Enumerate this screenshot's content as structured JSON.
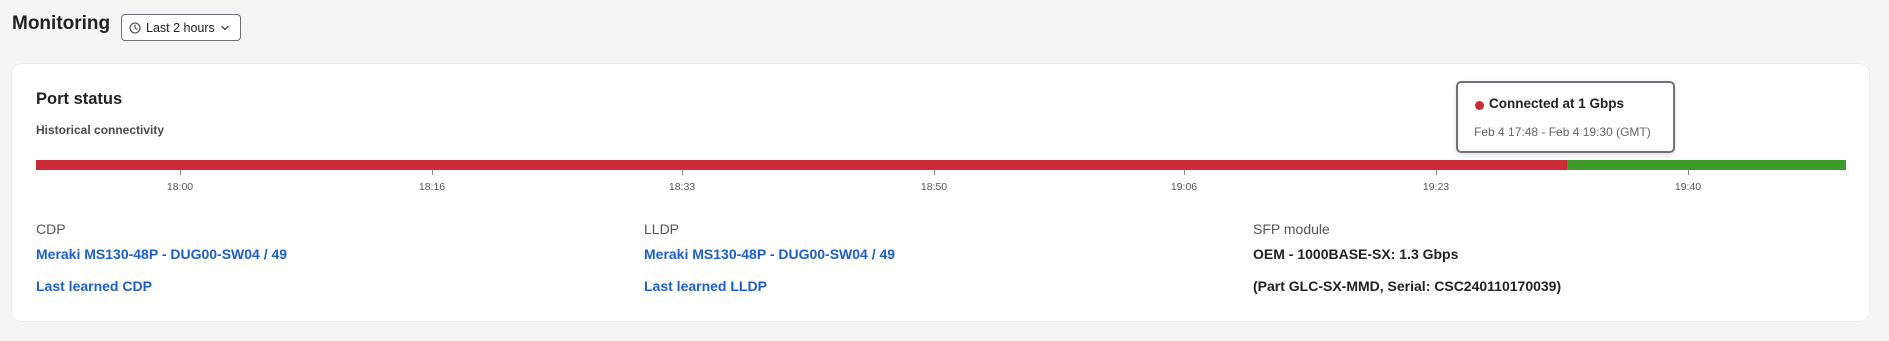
{
  "header": {
    "title": "Monitoring",
    "time_range": "Last 2 hours"
  },
  "card": {
    "title": "Port status",
    "subtitle": "Historical connectivity",
    "timeline": {
      "segments": [
        {
          "status": "disconnected",
          "color": "#cc2a36",
          "fraction": 0.846
        },
        {
          "status": "connected",
          "color": "#3e9a2b",
          "fraction": 0.154
        }
      ],
      "ticks": [
        "18:00",
        "18:16",
        "18:33",
        "18:50",
        "19:06",
        "19:23",
        "19:40"
      ]
    },
    "tooltip": {
      "title": "Connected at 1 Gbps",
      "range": "Feb 4 17:48 - Feb 4 19:30 (GMT)",
      "dot_color": "#cc2a36"
    },
    "cdp": {
      "heading": "CDP",
      "device": "Meraki MS130-48P - DUG00-SW04 / 49",
      "last_learned": "Last learned CDP"
    },
    "lldp": {
      "heading": "LLDP",
      "device": "Meraki MS130-48P - DUG00-SW04 / 49",
      "last_learned": "Last learned LLDP"
    },
    "sfp": {
      "heading": "SFP module",
      "module": "OEM - 1000BASE-SX: 1.3 Gbps",
      "detail": "(Part GLC-SX-MMD, Serial: CSC240110170039)"
    }
  },
  "colors": {
    "accent_link": "#1d5fc7",
    "status_red": "#cc2a36",
    "status_green": "#3e9a2b"
  },
  "icons": [
    "clock-icon",
    "chevron-down-icon"
  ]
}
